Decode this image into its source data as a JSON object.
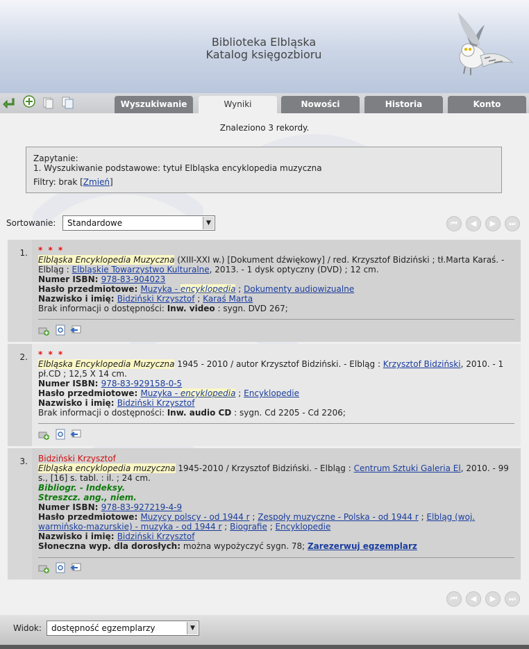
{
  "header": {
    "line1": "Biblioteka Elbląska",
    "line2": "Katalog księgozbioru",
    "logo_icon": "snowy-owl-logo"
  },
  "toolbar": {
    "icons": [
      "back-arrow-icon",
      "add-icon",
      "copy-icon",
      "copy-all-icon"
    ]
  },
  "tabs": [
    {
      "label": "Wyszukiwanie",
      "active": false
    },
    {
      "label": "Wyniki",
      "active": true
    },
    {
      "label": "Nowości",
      "active": false
    },
    {
      "label": "Historia",
      "active": false
    },
    {
      "label": "Konto",
      "active": false
    }
  ],
  "results": {
    "found_text": "Znaleziono 3 rekordy.",
    "query_label": "Zapytanie:",
    "query_line": "1.  Wyszukiwanie podstawowe: tytuł Elbląska encyklopedia muzyczna",
    "filters_label": "Filtry: brak [",
    "filters_link": "Zmień",
    "filters_end": "]"
  },
  "sort": {
    "label": "Sortowanie:",
    "value": "Standardowe"
  },
  "pager": {
    "buttons": [
      "first-page-icon",
      "prev-page-icon",
      "next-page-icon",
      "last-page-icon"
    ]
  },
  "records": [
    {
      "num": "1.",
      "stars": "* * *",
      "title": "Elbląska Encyklopedia Muzyczna",
      "desc_a": " (XIII-XXI w.) [Dokument dźwiękowy] / red. Krzysztof Bidziński ; tł.Marta Karaś. - Elbląg : ",
      "desc_link": "Elbląskie Towarzystwo Kulturalne",
      "desc_b": ", 2013. - 1 dysk optyczny (DVD) ; 12 cm.",
      "isbn_label": "Numer ISBN",
      "isbn": "978-83-904023",
      "subj_label": "Hasło przedmiotowe",
      "subj1_a": "Muzyka - ",
      "subj1_b": "encyklopedia",
      "subj2": "Dokumenty audiowizualne",
      "name_label": "Nazwisko i imię",
      "name1": "Bidziński Krzysztof",
      "name2": "Karaś Marta",
      "avail_a": "Brak informacji o dostępności: ",
      "avail_b": "Inw. video",
      "avail_c": " : sygn. DVD 267;"
    },
    {
      "num": "2.",
      "stars": "* * *",
      "title": "Elbląska Encyklopedia Muzyczna",
      "desc_a": " 1945 - 2010 / autor Krzysztof Bidziński. - Elbląg : ",
      "desc_link": "Krzysztof Bidziński",
      "desc_b": ", 2010. - 1 pł.CD ; 12,5 X 14 cm.",
      "isbn_label": "Numer ISBN",
      "isbn": "978-83-929158-0-5",
      "subj_label": "Hasło przedmiotowe",
      "subj1_a": "Muzyka - ",
      "subj1_b": "encyklopedia",
      "subj2": "Encyklopedie",
      "name_label": "Nazwisko i imię",
      "name1": "Bidziński Krzysztof",
      "avail_a": "Brak informacji o dostępności: ",
      "avail_b": "Inw. audio CD",
      "avail_c": " : sygn. Cd 2205 - Cd 2206;"
    },
    {
      "num": "3.",
      "author": "Bidziński Krzysztof",
      "title": "Elbląska encyklopedia muzyczna",
      "desc_a": " 1945-2010 / Krzysztof Bidziński. - Elbląg : ",
      "desc_link": "Centrum Sztuki Galeria El",
      "desc_b": ", 2010. - 99 s., [16] s. tabl. : il. ; 24 cm.",
      "note1": "Bibliogr. - Indeksy.",
      "note2": "Streszcz. ang., niem.",
      "isbn_label": "Numer ISBN",
      "isbn": "978-83-927219-4-9",
      "subj_label": "Hasło przedmiotowe",
      "subj1": "Muzycy polscy - od 1944 r",
      "subj2": "Zespoły muzyczne - Polska - od 1944 r",
      "subj3": "Elbląg (woj. warmińsko-mazurskie) - muzyka - od 1944 r",
      "subj4": "Biografie",
      "subj5": "Encyklopedie",
      "name_label": "Nazwisko i imię",
      "name1": "Bidziński Krzysztof",
      "loc_label": "Słoneczna wyp. dla dorosłych:",
      "loc_text": " można wypożyczyć sygn. 78; ",
      "reserve": "Zarezerwuj egzemplarz"
    }
  ],
  "record_icons": [
    "add-to-basket-icon",
    "details-icon",
    "export-icon"
  ],
  "view": {
    "label": "Widok:",
    "value": "dostępność egzemplarzy"
  },
  "colors": {
    "tab_bg": "#7d7f83",
    "link": "#1a3d9e",
    "stars": "#e01010",
    "green_note": "#0f7a0f",
    "header_bg": "#cbd5e6"
  }
}
